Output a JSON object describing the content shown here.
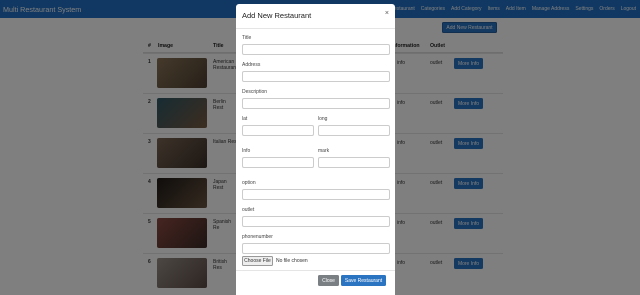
{
  "app": {
    "brand": "Multi Restaurant System"
  },
  "nav": [
    "Restaurant",
    "Categories",
    "Add Category",
    "Items",
    "Add Item",
    "Manage Address",
    "Settings",
    "Orders",
    "Logout"
  ],
  "add_button": "Add New Restaurant",
  "table": {
    "headers": [
      "#",
      "Image",
      "Title",
      "Information",
      "Outlet"
    ],
    "rows": [
      {
        "num": "1",
        "title": "American Restaurant",
        "info": "info",
        "outlet": "outlet",
        "action": "More Info",
        "thumb": "#6b5a45"
      },
      {
        "num": "2",
        "title": "Berlin Rest",
        "info": "info",
        "outlet": "outlet",
        "action": "More Info",
        "thumb": "#3d5a66"
      },
      {
        "num": "3",
        "title": "Italian Res",
        "info": "info",
        "outlet": "outlet",
        "action": "More Info",
        "thumb": "#5b4a3f"
      },
      {
        "num": "4",
        "title": "Japan Rest",
        "info": "info",
        "outlet": "outlet",
        "action": "More Info",
        "thumb": "#2f2a26"
      },
      {
        "num": "5",
        "title": "Spanish Re",
        "info": "info",
        "outlet": "outlet",
        "action": "More Info",
        "thumb": "#7a3f3a"
      },
      {
        "num": "6",
        "title": "British Res",
        "info": "info",
        "outlet": "outlet",
        "action": "More Info",
        "thumb": "#6e6763"
      }
    ]
  },
  "modal": {
    "title": "Add New Restaurant",
    "close_icon": "×",
    "fields": {
      "title": {
        "label": "Title",
        "value": ""
      },
      "address": {
        "label": "Address",
        "value": ""
      },
      "description": {
        "label": "Description",
        "value": ""
      },
      "lat": {
        "label": "lat",
        "value": ""
      },
      "long": {
        "label": "long",
        "value": ""
      },
      "info": {
        "label": "Info",
        "value": ""
      },
      "mark": {
        "label": "mark",
        "value": ""
      },
      "option": {
        "label": "option",
        "value": ""
      },
      "outlet": {
        "label": "outlet",
        "value": ""
      },
      "phonenumber": {
        "label": "phonenumber",
        "value": ""
      }
    },
    "file_button": "Choose File",
    "file_status": "No file chosen",
    "close_button": "Close",
    "save_button": "Save Restaurant"
  }
}
